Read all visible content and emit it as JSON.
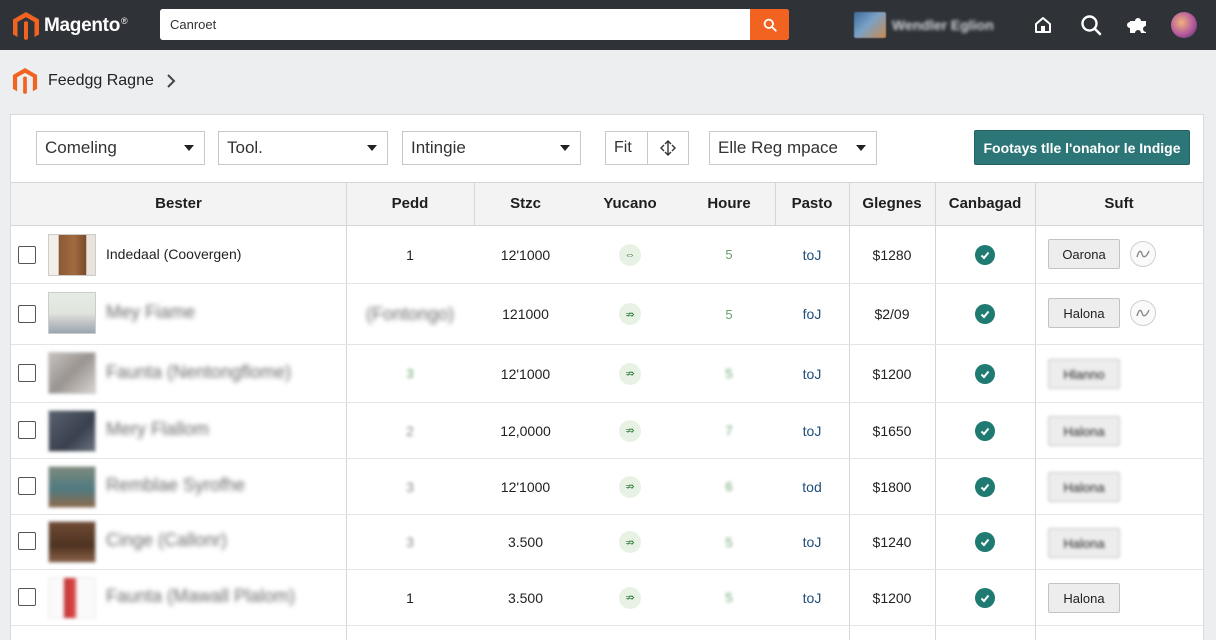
{
  "app": {
    "logo_text": "Magento",
    "logo_mark": "®"
  },
  "search": {
    "value": "Canroet"
  },
  "store": {
    "name": "Wendler Eglion"
  },
  "icons": {
    "search": "search-icon",
    "home": "home-icon",
    "magnifier": "magnifier-icon",
    "extensions": "puzzle-icon",
    "avatar": "avatar"
  },
  "breadcrumb": {
    "title": "Feedgg Ragne"
  },
  "filters": {
    "select1": "Comeling",
    "select2": "Tool.",
    "select3": "Intingie",
    "fit_label": "Fit",
    "select4": "Elle Reg mpace",
    "action": "Footays tlle l'onahor le Indige"
  },
  "columns": [
    "Bester",
    "Pedd",
    "Stzc",
    "Yucano",
    "Houre",
    "Pasto",
    "Glegnes",
    "Canbagad",
    "Suft"
  ],
  "rows": [
    {
      "name": "Indedaal (Coovergen)",
      "pedd": "1",
      "stzc": "12'1000",
      "yucano": "⇔",
      "houre": "5",
      "pasto": "toJ",
      "glegnes": "$1280",
      "button": "Oarona"
    },
    {
      "name": "Mey Fiame",
      "pedd": "(Fontongo)",
      "stzc": "121000",
      "yucano": "⇏",
      "houre": "5",
      "pasto": "foJ",
      "glegnes": "$2/09",
      "button": "Halona"
    },
    {
      "name": "Faunta (Nentongflome)",
      "pedd": "3",
      "stzc": "12'1000",
      "yucano": "⇏",
      "houre": "5",
      "pasto": "toJ",
      "glegnes": "$1200",
      "button": "Hlanno"
    },
    {
      "name": "Mery Flallom",
      "pedd": "2",
      "stzc": "12,0000",
      "yucano": "⇏",
      "houre": "7",
      "pasto": "toJ",
      "glegnes": "$1650",
      "button": "Halona"
    },
    {
      "name": "Remblae Syrofhe",
      "pedd": "3",
      "stzc": "12'1000",
      "yucano": "⇏",
      "houre": "6",
      "pasto": "tod",
      "glegnes": "$1800",
      "button": "Halona"
    },
    {
      "name": "Cinge (Callonr)",
      "pedd": "3",
      "stzc": "3.500",
      "yucano": "⇏",
      "houre": "5",
      "pasto": "toJ",
      "glegnes": "$1240",
      "button": "Halona"
    },
    {
      "name": "Faunta (Mawall Plalom)",
      "pedd": "1",
      "stzc": "3.500",
      "yucano": "⇏",
      "houre": "5",
      "pasto": "toJ",
      "glegnes": "$1200",
      "button": "Halona"
    }
  ],
  "colors": {
    "accent": "#f26322",
    "header_bg": "#2f3338",
    "action_bg": "#2d7678",
    "check": "#1f7b72"
  }
}
